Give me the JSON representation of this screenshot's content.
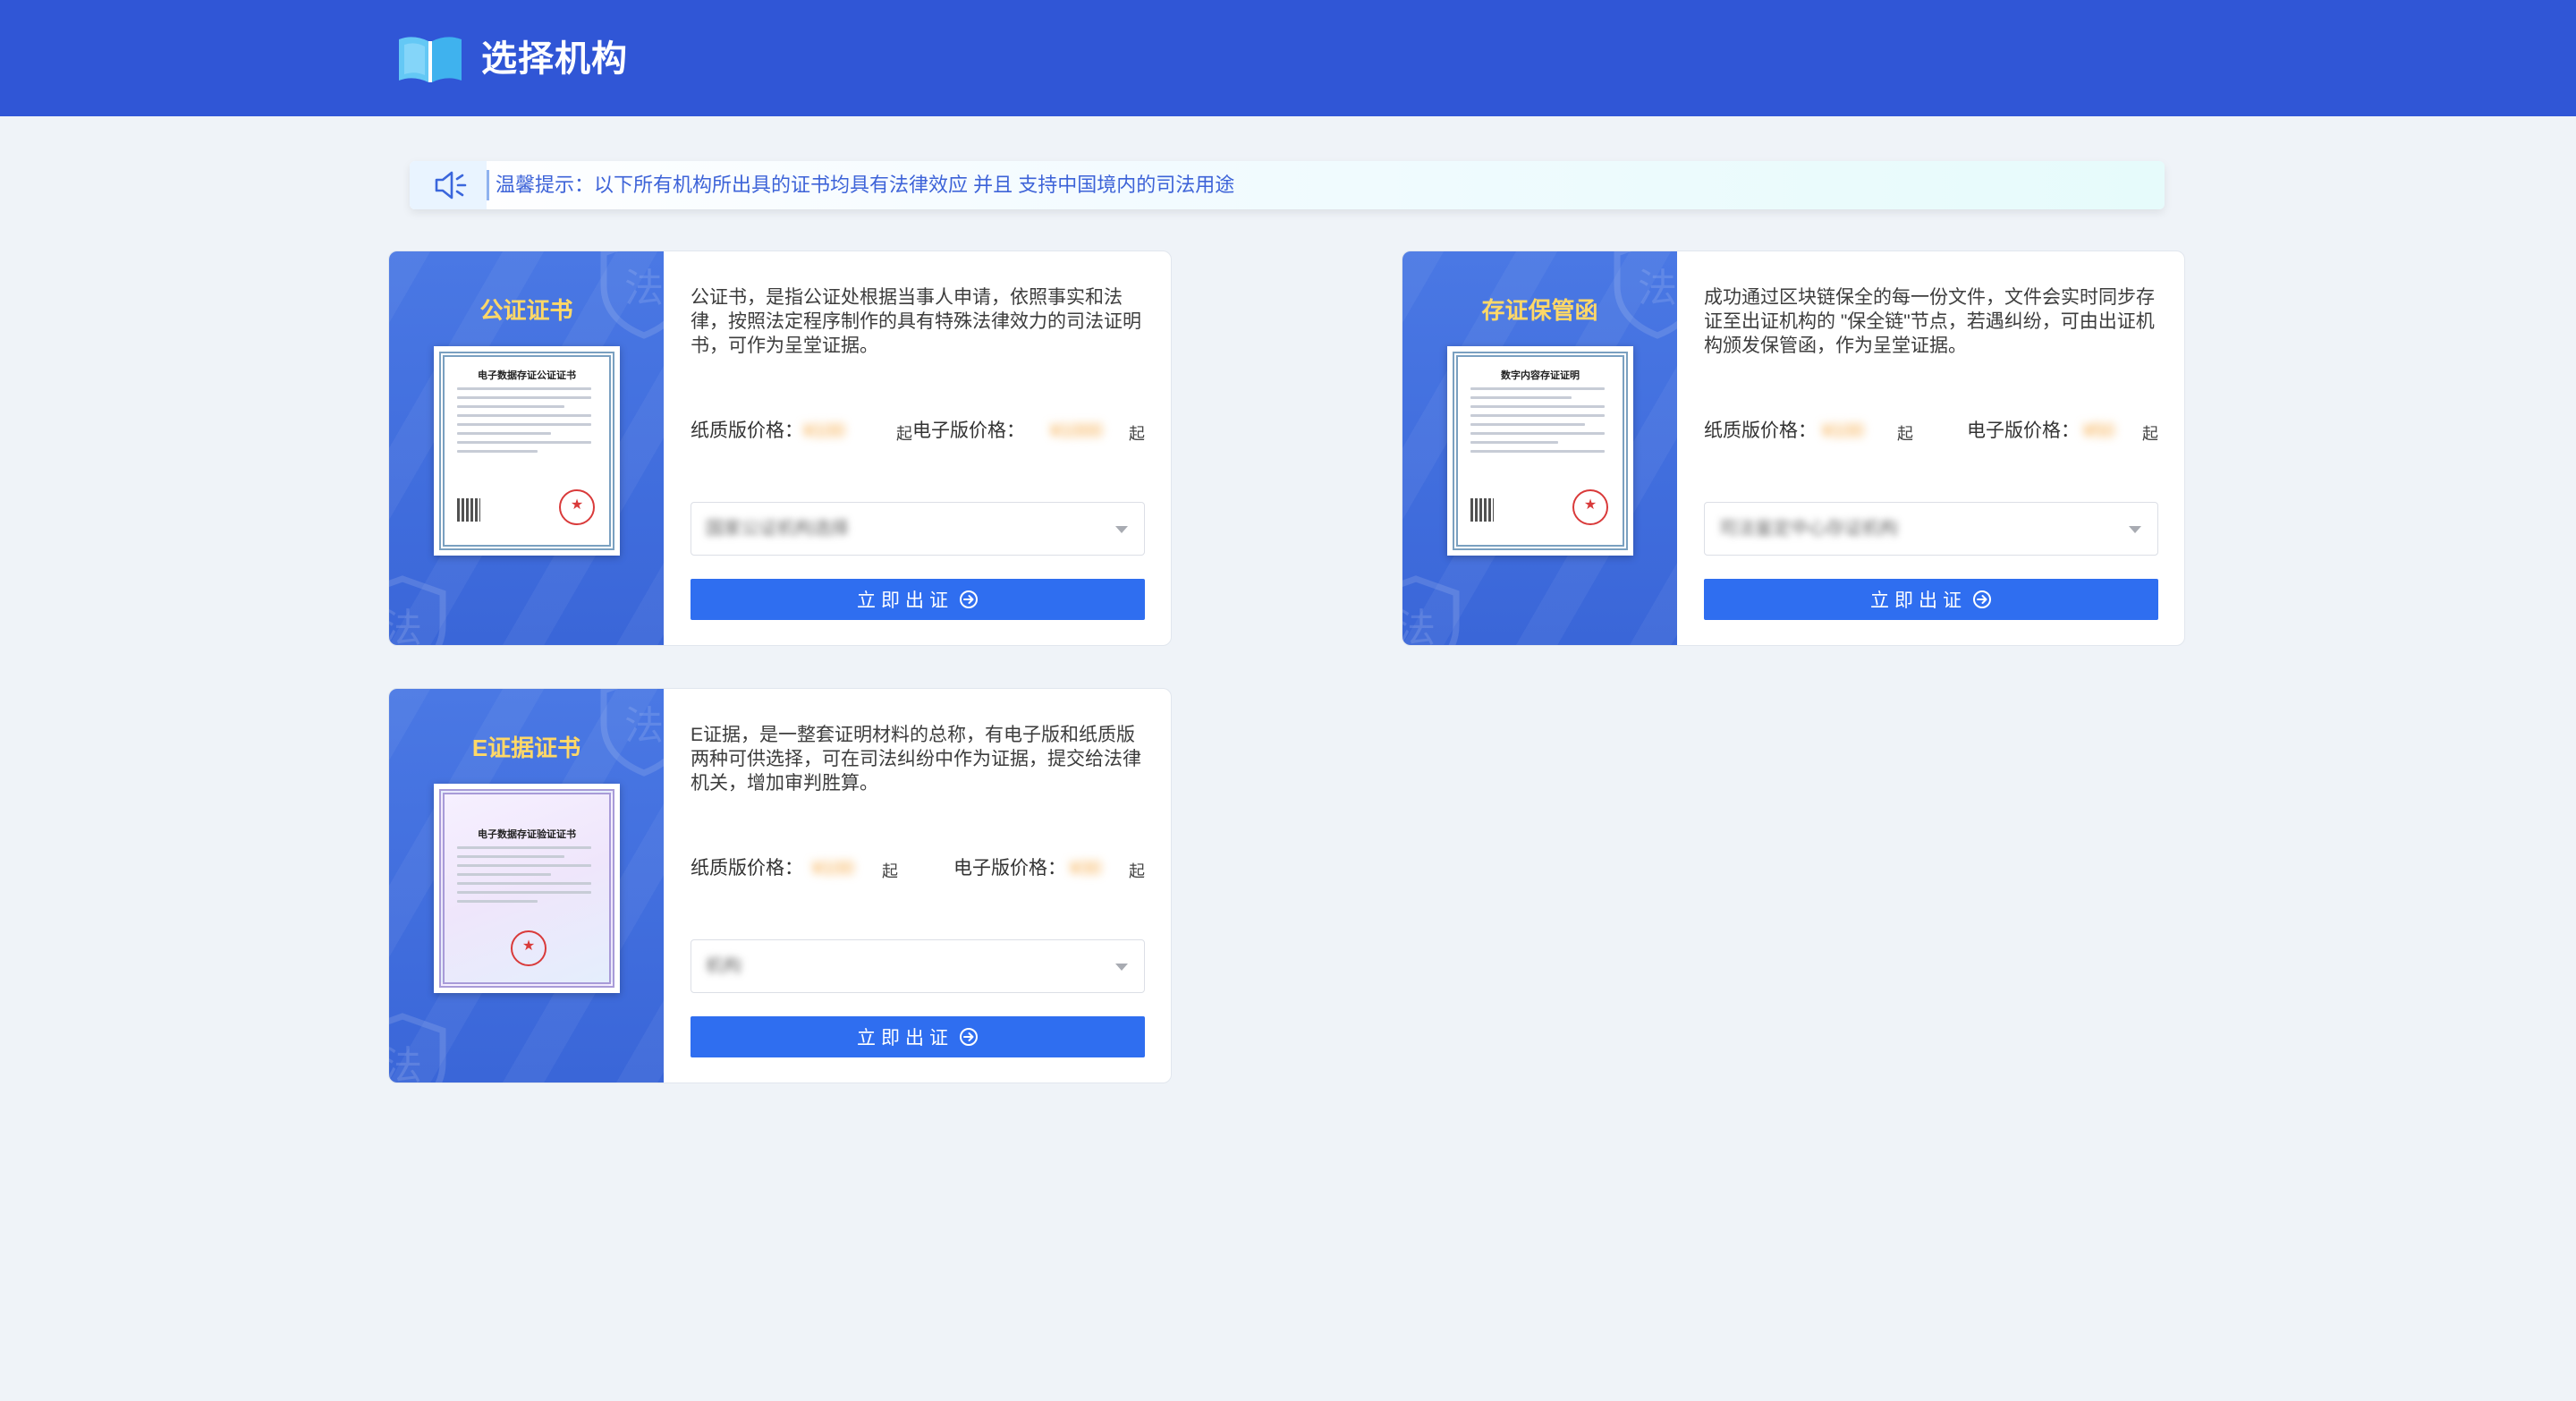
{
  "header": {
    "title": "选择机构"
  },
  "notice": {
    "text": "温馨提示：以下所有机构所出具的证书均具有法律效应 并且 支持中国境内的司法用途"
  },
  "cards": [
    {
      "title": "公证证书",
      "certificate_heading": "电子数据存证公证证书",
      "description": "公证书，是指公证处根据当事人申请，依照事实和法律，按照法定程序制作的具有特殊法律效力的司法证明书，可作为呈堂证据。",
      "paper_price_label": "纸质版价格：",
      "paper_price": "¥100",
      "electronic_price_label": "电子版价格：",
      "electronic_price": "¥1000",
      "price_suffix": "起",
      "select_value": "国家公证机构选择",
      "button_label": "立即出证"
    },
    {
      "title": "存证保管函",
      "certificate_heading": "数字内容存证证明",
      "description": "成功通过区块链保全的每一份文件，文件会实时同步存证至出证机构的 \"保全链\"节点，若遇纠纷，可由出证机构颁发保管函，作为呈堂证据。",
      "paper_price_label": "纸质版价格：",
      "paper_price": "¥100",
      "electronic_price_label": "电子版价格：",
      "electronic_price": "¥50",
      "price_suffix": "起",
      "select_value": "司法鉴定中心存证机构",
      "button_label": "立即出证"
    },
    {
      "title": "E证据证书",
      "certificate_heading": "电子数据存证验证证书",
      "description": "E证据，是一整套证明材料的总称，有电子版和纸质版两种可供选择，可在司法纠纷中作为证据，提交给法律机关，增加审判胜算。",
      "paper_price_label": "纸质版价格：",
      "paper_price": "¥100",
      "electronic_price_label": "电子版价格：",
      "electronic_price": "¥30",
      "price_suffix": "起",
      "select_value": "机构",
      "button_label": "立即出证"
    }
  ],
  "colors": {
    "header_bg": "#3056d6",
    "page_bg": "#eff3f8",
    "card_title": "#ffd867",
    "button_bg": "#2f6ef0",
    "price_highlight": "#f5a134",
    "notice_text": "#3d63d8"
  },
  "icons": [
    "open-book-logo-icon",
    "speaker-icon",
    "arrow-circle-right-icon",
    "law-shield-watermark-icon",
    "chevron-down-icon"
  ]
}
